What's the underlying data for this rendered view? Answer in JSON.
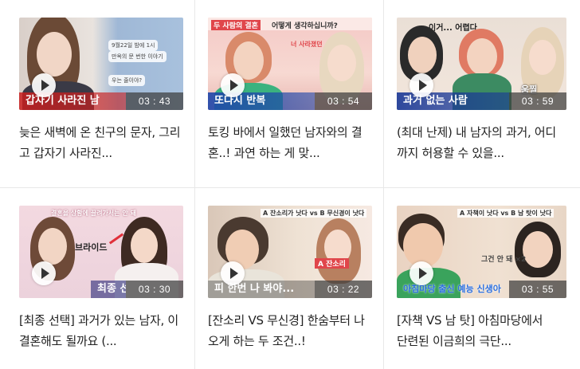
{
  "videos": [
    {
      "title": "늦은 새벽에 온 친구의 문자, 그리고 갑자기 사라진...",
      "duration": "03 : 43",
      "thumb_caption": "갑자기 사라진 남",
      "thumb_texts": [
        "9월22일 밤에 1시",
        "만옥의 문 번한 이야기",
        "우는 줄이야?"
      ]
    },
    {
      "title": "토킹 바에서 일했던 남자와의 결혼..! 과연 하는 게 맞...",
      "duration": "03 : 54",
      "thumb_caption": "또다시 반복",
      "thumb_texts": [
        "두 사람의 결혼",
        "어떻게 생각하십니까?",
        "너 사라졌던"
      ]
    },
    {
      "title": "(최대 난제) 내 남자의 과거, 어디까지 허용할 수 있을...",
      "duration": "03 : 59",
      "thumb_caption": "과거 없는 사람",
      "thumb_texts": [
        "이거... 어렵다",
        "움찔"
      ]
    },
    {
      "title": "[최종 선택] 과거가 있는 남자, 이 결혼해도 될까요 (...",
      "duration": "03 : 30",
      "thumb_caption": "최종 선택",
      "thumb_texts": [
        "결혼을 상황에 끌려가서는 안 돼",
        "브라이드"
      ]
    },
    {
      "title": "[잔소리 VS 무신경] 한숨부터 나오게 하는 두 조건..!",
      "duration": "03 : 22",
      "thumb_caption": "피 한번 나 봐야...",
      "thumb_texts": [
        "A 잔소리가 낫다 vs B 무신경이 낫다",
        "A 잔소리"
      ]
    },
    {
      "title": "[자책 VS 남 탓] 아침마당에서 단련된 이금희의 극단...",
      "duration": "03 : 55",
      "thumb_caption": "아침마당 출신 예능 신생아",
      "thumb_texts": [
        "A 자책이 낫다 vs B 남 탓이 낫다",
        "그건 안 돼 ×2"
      ]
    }
  ]
}
